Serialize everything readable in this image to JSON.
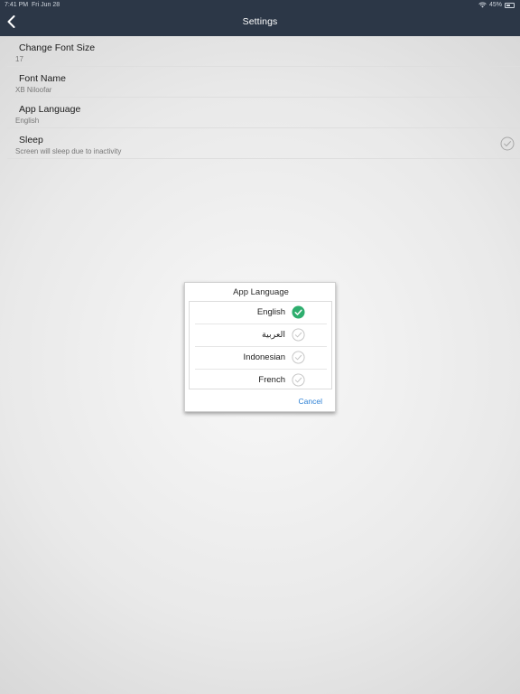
{
  "status_bar": {
    "time": "7:41 PM",
    "date": "Fri Jun 28",
    "battery": "45%"
  },
  "navbar": {
    "title": "Settings"
  },
  "settings": [
    {
      "title": "Change Font Size",
      "subtitle": "17"
    },
    {
      "title": "Font Name",
      "subtitle": "XB Niloofar"
    },
    {
      "title": "App Language",
      "subtitle": "English"
    },
    {
      "title": "Sleep",
      "subtitle": "Screen will sleep due to inactivity",
      "checked": false
    }
  ],
  "dialog": {
    "title": "App Language",
    "options": [
      {
        "label": "English",
        "selected": true
      },
      {
        "label": "العربية",
        "selected": false
      },
      {
        "label": "Indonesian",
        "selected": false
      },
      {
        "label": "French",
        "selected": false
      }
    ],
    "cancel_label": "Cancel"
  },
  "colors": {
    "navbar_bg": "#2c3747",
    "accent_blue": "#2b7fd4",
    "check_green": "#2eae6e"
  }
}
